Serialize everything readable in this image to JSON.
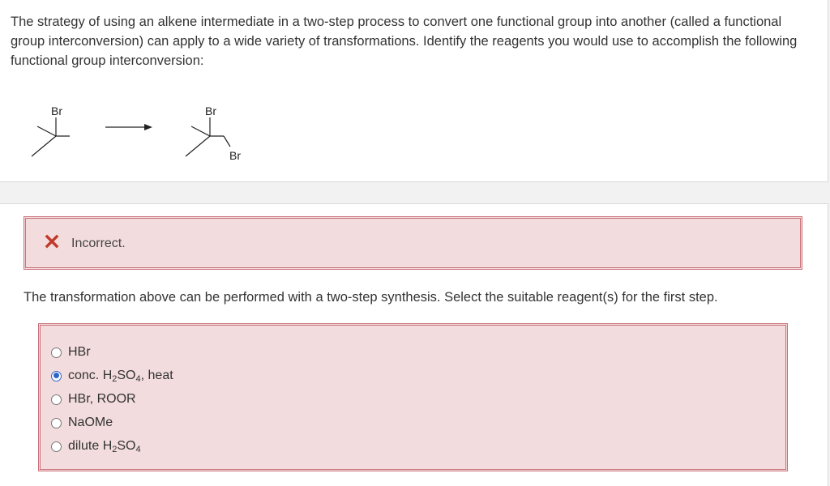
{
  "question": {
    "text": "The strategy of using an alkene intermediate in a two-step process to convert one functional group into another (called a functional group interconversion) can apply to a wide variety of transformations. Identify the reagents you would use to accomplish the following functional group interconversion:"
  },
  "scheme": {
    "reactant_label": "Br",
    "product_label_top": "Br",
    "product_label_bottom": "Br"
  },
  "feedback": {
    "status": "Incorrect.",
    "status_color": "#c0392b"
  },
  "prompt": "The transformation above can be performed with a two-step synthesis. Select the suitable reagent(s) for the first step.",
  "options": [
    {
      "pre": "HBr",
      "sub1": "",
      "mid": "",
      "sub2": "",
      "post": "",
      "selected": false
    },
    {
      "pre": "conc. H",
      "sub1": "2",
      "mid": "SO",
      "sub2": "4",
      "post": ", heat",
      "selected": true
    },
    {
      "pre": "HBr, ROOR",
      "sub1": "",
      "mid": "",
      "sub2": "",
      "post": "",
      "selected": false
    },
    {
      "pre": "NaOMe",
      "sub1": "",
      "mid": "",
      "sub2": "",
      "post": "",
      "selected": false
    },
    {
      "pre": "dilute H",
      "sub1": "2",
      "mid": "SO",
      "sub2": "4",
      "post": "",
      "selected": false
    }
  ],
  "colors": {
    "accent": "#2f65c8",
    "error_border": "#c9727a",
    "error_bg": "#f3dcdd"
  }
}
